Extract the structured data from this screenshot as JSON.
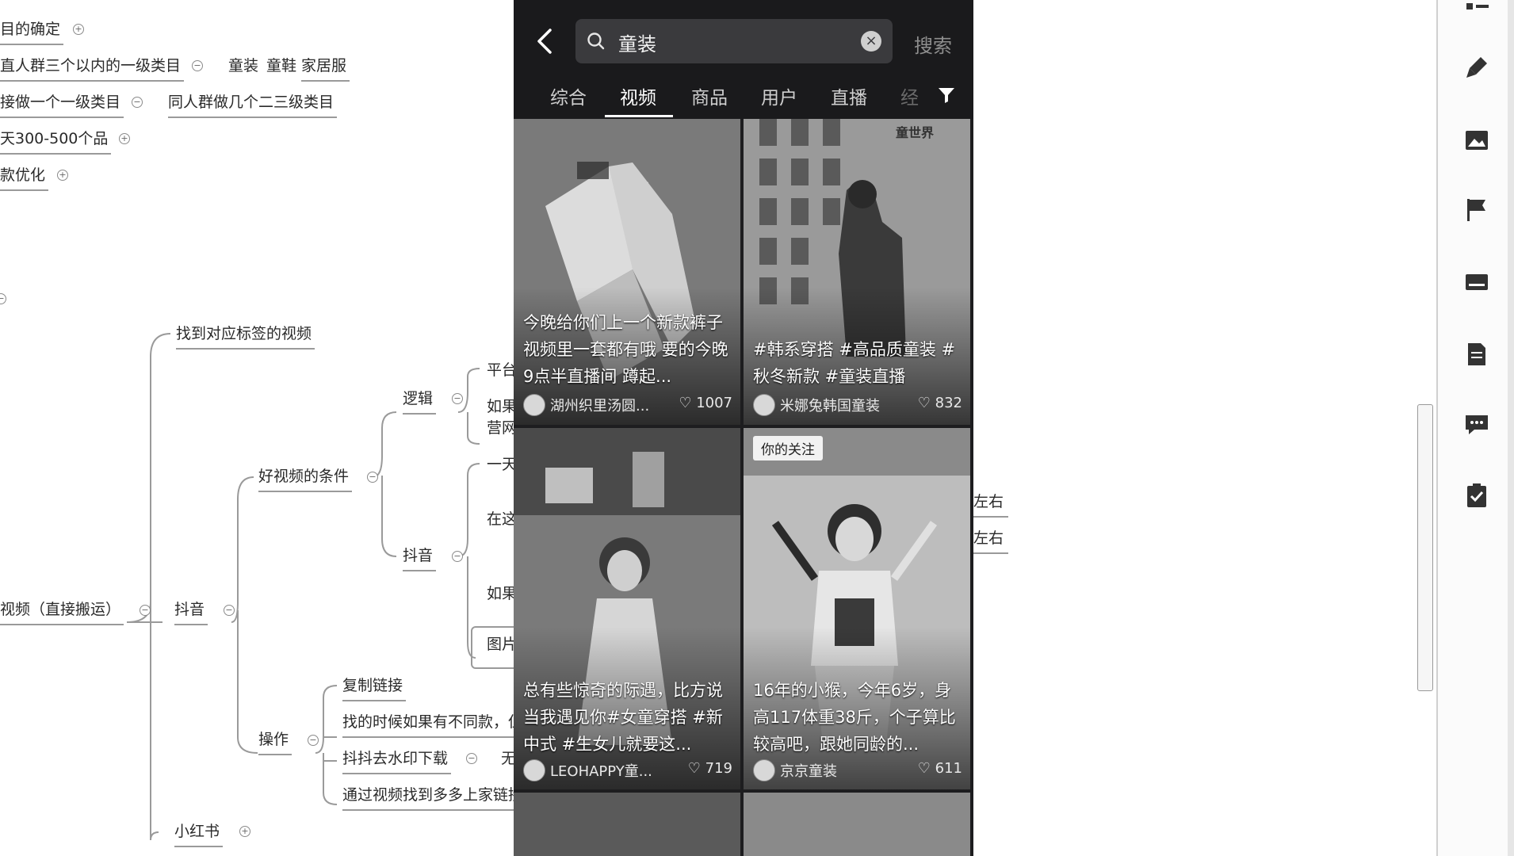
{
  "mindmap": {
    "nodes": {
      "n1": "目的确定",
      "n2": "直人群三个以内的一级类目",
      "n2a": "童装",
      "n2b": "童鞋",
      "n2c": "家居服",
      "n3": "接做一个一级类目",
      "n3a": "同人群做几个二三级类目",
      "n4": "天300-500个品",
      "n5": "款优化",
      "n6": "找到对应标签的视频",
      "n7": "逻辑",
      "n7a": "平台",
      "n7b": "如果",
      "n7c": "营网",
      "n8": "好视频的条件",
      "n8a": "一天",
      "n8b": "在这",
      "n9": "抖音",
      "n9a": "如果",
      "n9b": "图片",
      "n10": "视频（直接搬运）",
      "n11": "抖音",
      "n12": "复制链接",
      "n13": "找的时候如果有不同款，但",
      "n14": "操作",
      "n15": "抖抖去水印下载",
      "n15a": "无",
      "n16": "通过视频找到多多上家链接",
      "n17": "小红书",
      "r1": "左右",
      "r2": "左右"
    }
  },
  "phone": {
    "search_query": "童装",
    "search_button": "搜索",
    "tabs": [
      "综合",
      "视频",
      "商品",
      "用户",
      "直播",
      "经"
    ],
    "active_tab": "视频",
    "cards": [
      {
        "caption": "今晚给你们上一个新款裤子 视频里一套都有哦 要的今晚9点半直播间 蹲起...",
        "author": "湖州织里汤圆...",
        "likes": "1007",
        "badge": ""
      },
      {
        "caption": "#韩系穿搭 #高品质童装 #秋冬新款 #童装直播",
        "author": "米娜兔韩国童装",
        "likes": "832",
        "badge": "",
        "watermark": "童世界"
      },
      {
        "caption": "总有些惊奇的际遇，比方说当我遇见你#女童穿搭 #新中式 #生女儿就要这...",
        "author": "LEOHAPPY童...",
        "likes": "719",
        "badge": ""
      },
      {
        "caption": "16年的小猴，今年6岁，身高117体重38斤，个子算比较高吧，跟她同龄的...",
        "author": "京京童装",
        "likes": "611",
        "badge": "你的关注"
      }
    ]
  },
  "right_panel": {
    "icons": [
      "outline-icon",
      "brush-icon",
      "image-icon",
      "flag-icon",
      "label-icon",
      "note-icon",
      "comment-icon",
      "task-icon"
    ]
  },
  "colors": {
    "phone_bg": "#1d1d1f",
    "search_bg": "#3a3a3d",
    "text_dark": "#2a2a2a"
  }
}
